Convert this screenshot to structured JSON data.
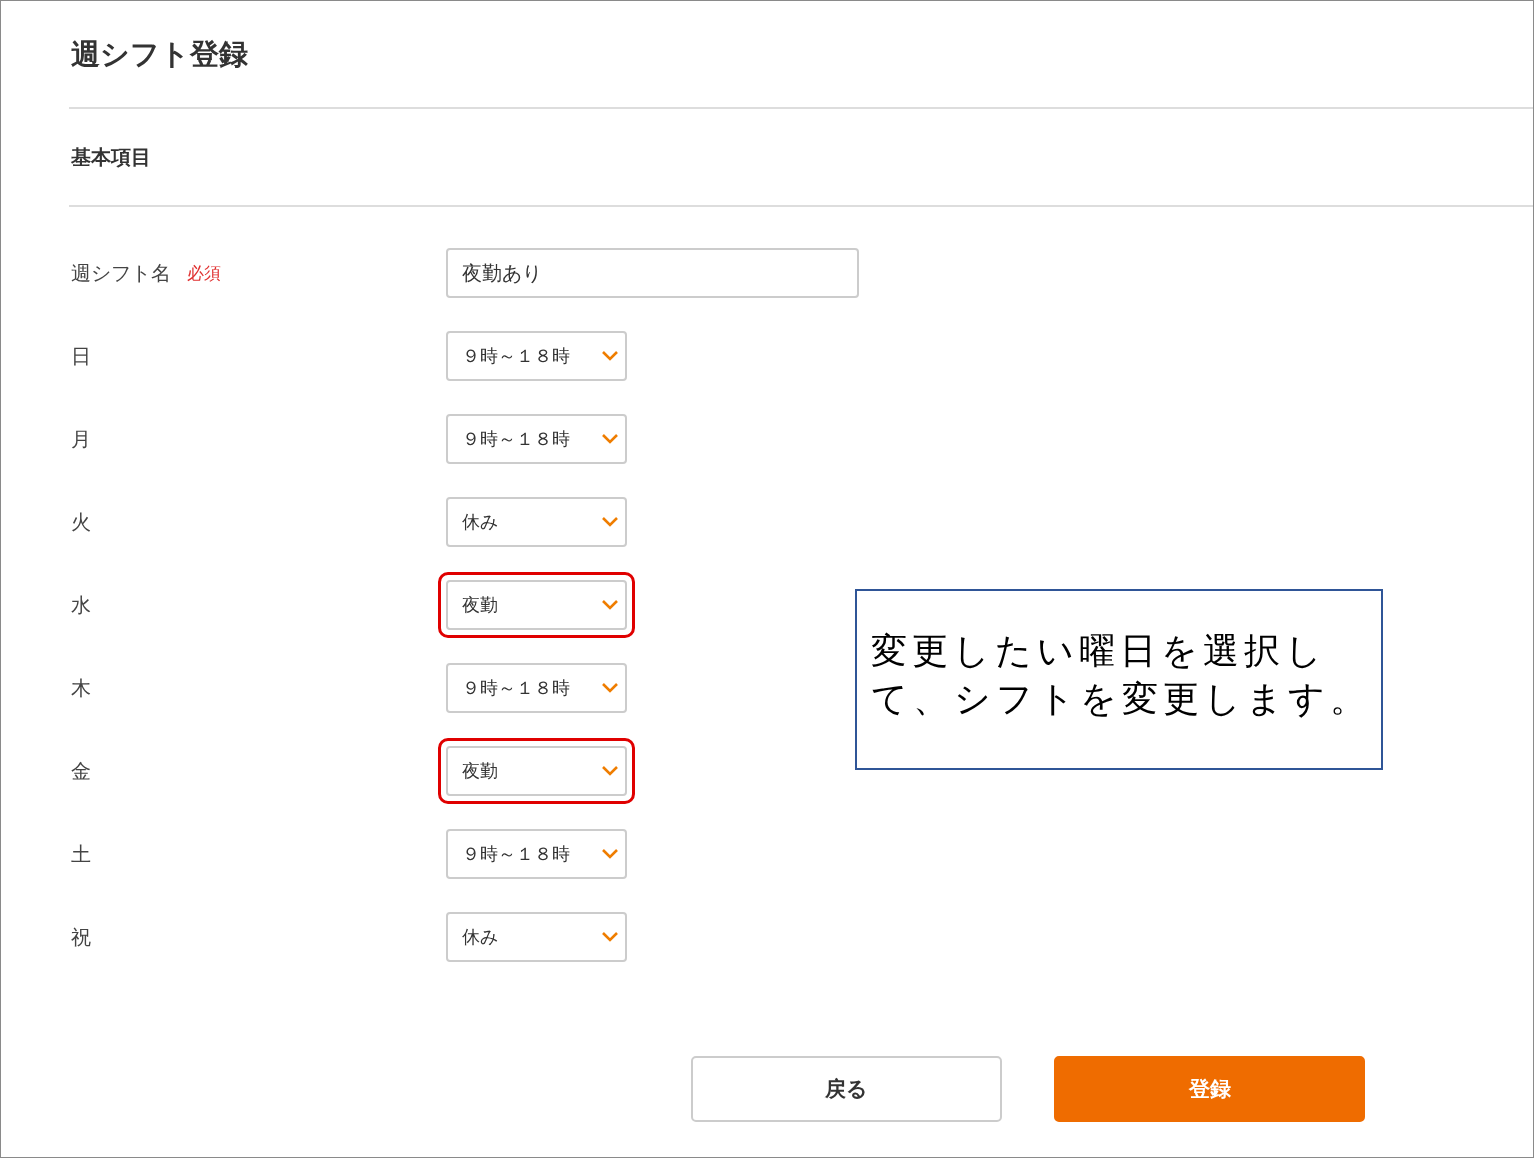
{
  "page": {
    "title": "週シフト登録",
    "section": "基本項目"
  },
  "fields": [
    {
      "kind": "text",
      "label": "週シフト名",
      "badge": "必須",
      "value": "夜勤あり",
      "highlighted": false
    },
    {
      "kind": "select",
      "label": "日",
      "value": "９時～１８時",
      "highlighted": false
    },
    {
      "kind": "select",
      "label": "月",
      "value": "９時～１８時",
      "highlighted": false
    },
    {
      "kind": "select",
      "label": "火",
      "value": "休み",
      "highlighted": false
    },
    {
      "kind": "select",
      "label": "水",
      "value": "夜勤",
      "highlighted": true
    },
    {
      "kind": "select",
      "label": "木",
      "value": "９時～１８時",
      "highlighted": false
    },
    {
      "kind": "select",
      "label": "金",
      "value": "夜勤",
      "highlighted": true
    },
    {
      "kind": "select",
      "label": "土",
      "value": "９時～１８時",
      "highlighted": false
    },
    {
      "kind": "select",
      "label": "祝",
      "value": "休み",
      "highlighted": false
    }
  ],
  "buttons": [
    {
      "kind": "secondary",
      "label": "戻る"
    },
    {
      "kind": "primary",
      "label": "登録"
    }
  ],
  "callout": {
    "lines": [
      "変更したい曜日を選択し",
      "て、シフトを変更します。"
    ]
  }
}
